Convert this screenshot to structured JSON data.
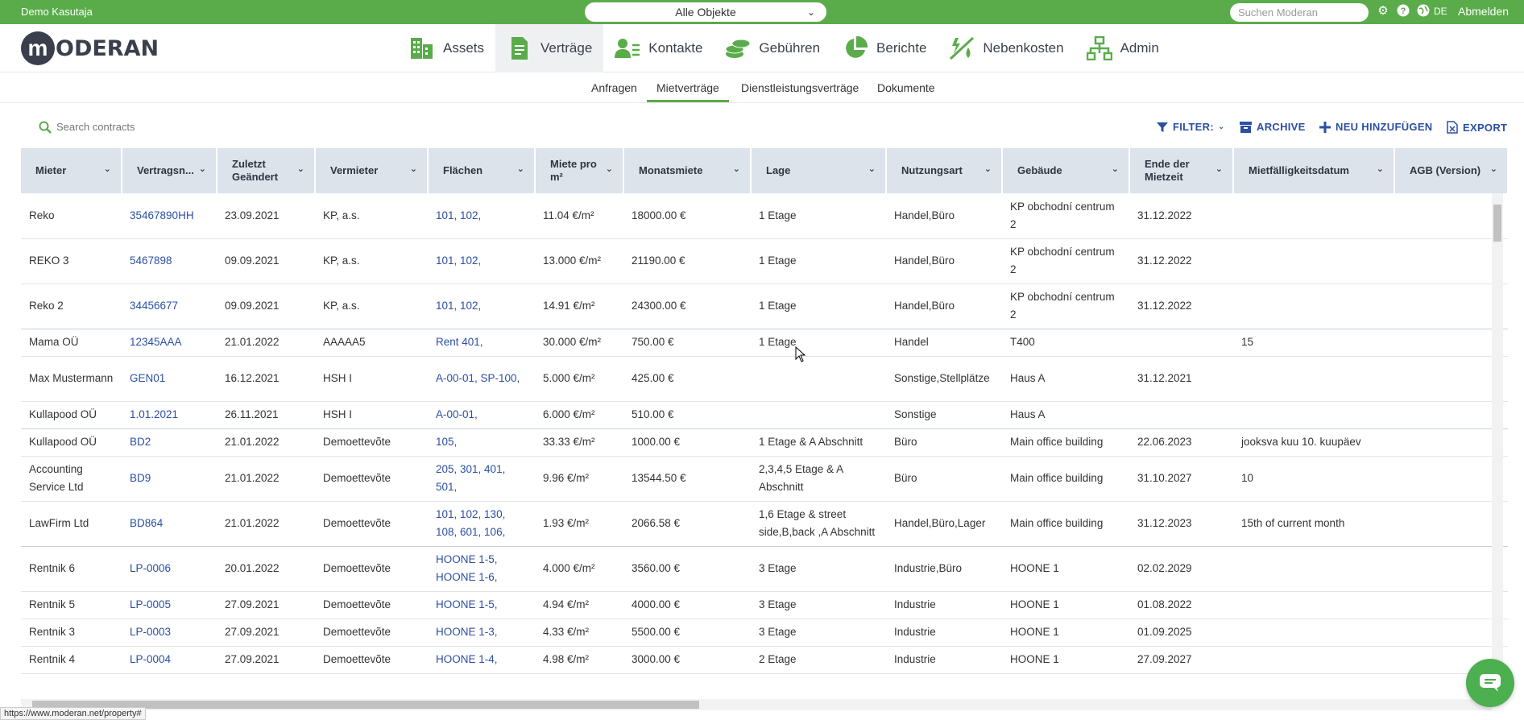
{
  "topbar": {
    "user": "Demo Kasutaja",
    "object_select": "Alle Objekte",
    "search_placeholder": "Suchen Moderan",
    "lang": "DE",
    "logout": "Abmelden"
  },
  "logo": {
    "letter": "m",
    "word": "ODERAN"
  },
  "nav": [
    {
      "label": "Assets",
      "icon": "buildings-icon"
    },
    {
      "label": "Verträge",
      "icon": "document-icon"
    },
    {
      "label": "Kontakte",
      "icon": "contacts-icon"
    },
    {
      "label": "Gebühren",
      "icon": "coins-icon"
    },
    {
      "label": "Berichte",
      "icon": "pie-chart-icon"
    },
    {
      "label": "Nebenkosten",
      "icon": "utilities-icon"
    },
    {
      "label": "Admin",
      "icon": "org-chart-icon"
    }
  ],
  "subnav": [
    "Anfragen",
    "Mietverträge",
    "Dienstleistungsverträge",
    "Dokumente"
  ],
  "toolbar": {
    "search_placeholder": "Search contracts",
    "filter": "FILTER:",
    "archive": "ARCHIVE",
    "add_new": "NEU HINZUFÜGEN",
    "export": "EXPORT"
  },
  "columns": [
    "Mieter",
    "Vertragsn...",
    "Zuletzt Geändert",
    "Vermieter",
    "Flächen",
    "Miete pro m²",
    "Monatsmiete",
    "Lage",
    "Nutzungsart",
    "Gebäude",
    "Ende der Mietzeit",
    "Mietfälligkeitsdatum",
    "AGB (Version)"
  ],
  "rows": [
    [
      "Reko",
      "35467890HH",
      "23.09.2021",
      "KP, a.s.",
      "101, 102,",
      "11.04 €/m²",
      "18000.00 €",
      "1 Etage",
      "Handel,Büro",
      "KP obchodní centrum 2",
      "31.12.2022",
      "",
      ""
    ],
    [
      "REKO 3",
      "5467898",
      "09.09.2021",
      "KP, a.s.",
      "101, 102,",
      "13.000 €/m²",
      "21190.00 €",
      "1 Etage",
      "Handel,Büro",
      "KP obchodní centrum 2",
      "31.12.2022",
      "",
      ""
    ],
    [
      "Reko 2",
      "34456677",
      "09.09.2021",
      "KP, a.s.",
      "101, 102,",
      "14.91 €/m²",
      "24300.00 €",
      "1 Etage",
      "Handel,Büro",
      "KP obchodní centrum 2",
      "31.12.2022",
      "",
      ""
    ],
    [
      "Mama OÜ",
      "12345AAA",
      "21.01.2022",
      "AAAAA5",
      "Rent 401,",
      "30.000 €/m²",
      "750.00 €",
      "1 Etage",
      "Handel",
      "T400",
      "",
      "15",
      ""
    ],
    [
      "Max Mustermann",
      "GEN01",
      "16.12.2021",
      "HSH I",
      "A-00-01, SP-100,",
      "5.000 €/m²",
      "425.00 €",
      "",
      "Sonstige,Stellplätze",
      "Haus A",
      "31.12.2021",
      "",
      ""
    ],
    [
      "Kullapood OÜ",
      "1.01.2021",
      "26.11.2021",
      "HSH I",
      "A-00-01,",
      "6.000 €/m²",
      "510.00 €",
      "",
      "Sonstige",
      "Haus A",
      "",
      "",
      ""
    ],
    [
      "Kullapood OÜ",
      "BD2",
      "21.01.2022",
      "Demoettevõte",
      "105,",
      "33.33 €/m²",
      "1000.00 €",
      "1 Etage & A Abschnitt",
      "Büro",
      "Main office building",
      "22.06.2023",
      "jooksva kuu 10. kuupäev",
      ""
    ],
    [
      "Accounting Service Ltd",
      "BD9",
      "21.01.2022",
      "Demoettevõte",
      "205, 301, 401, 501,",
      "9.96 €/m²",
      "13544.50 €",
      "2,3,4,5 Etage & A Abschnitt",
      "Büro",
      "Main office building",
      "31.10.2027",
      "10",
      ""
    ],
    [
      "LawFirm Ltd",
      "BD864",
      "21.01.2022",
      "Demoettevõte",
      "101, 102, 130, 108, 601, 106,",
      "1.93 €/m²",
      "2066.58 €",
      "1,6 Etage & street side,B,back ,A Abschnitt",
      "Handel,Büro,Lager",
      "Main office building",
      "31.12.2023",
      "15th of current month",
      ""
    ],
    [
      "Rentnik 6",
      "LP-0006",
      "20.01.2022",
      "Demoettevõte",
      "HOONE 1-5, HOONE 1-6,",
      "4.000 €/m²",
      "3560.00 €",
      "3 Etage",
      "Industrie,Büro",
      "HOONE 1",
      "02.02.2029",
      "",
      ""
    ],
    [
      "Rentnik 5",
      "LP-0005",
      "27.09.2021",
      "Demoettevõte",
      "HOONE 1-5,",
      "4.94 €/m²",
      "4000.00 €",
      "3 Etage",
      "Industrie",
      "HOONE 1",
      "01.08.2022",
      "",
      ""
    ],
    [
      "Rentnik 3",
      "LP-0003",
      "27.09.2021",
      "Demoettevõte",
      "HOONE 1-3,",
      "4.33 €/m²",
      "5500.00 €",
      "3 Etage",
      "Industrie",
      "HOONE 1",
      "01.09.2025",
      "",
      ""
    ],
    [
      "Rentnik 4",
      "LP-0004",
      "27.09.2021",
      "Demoettevõte",
      "HOONE 1-4,",
      "4.98 €/m²",
      "3000.00 €",
      "2 Etage",
      "Industrie",
      "HOONE 1",
      "27.09.2027",
      "",
      ""
    ]
  ],
  "status_url": "https://www.moderan.net/property#",
  "colors": {
    "green": "#5aac4a",
    "link": "#2c4fa3",
    "header_bg": "#dde3eb"
  }
}
